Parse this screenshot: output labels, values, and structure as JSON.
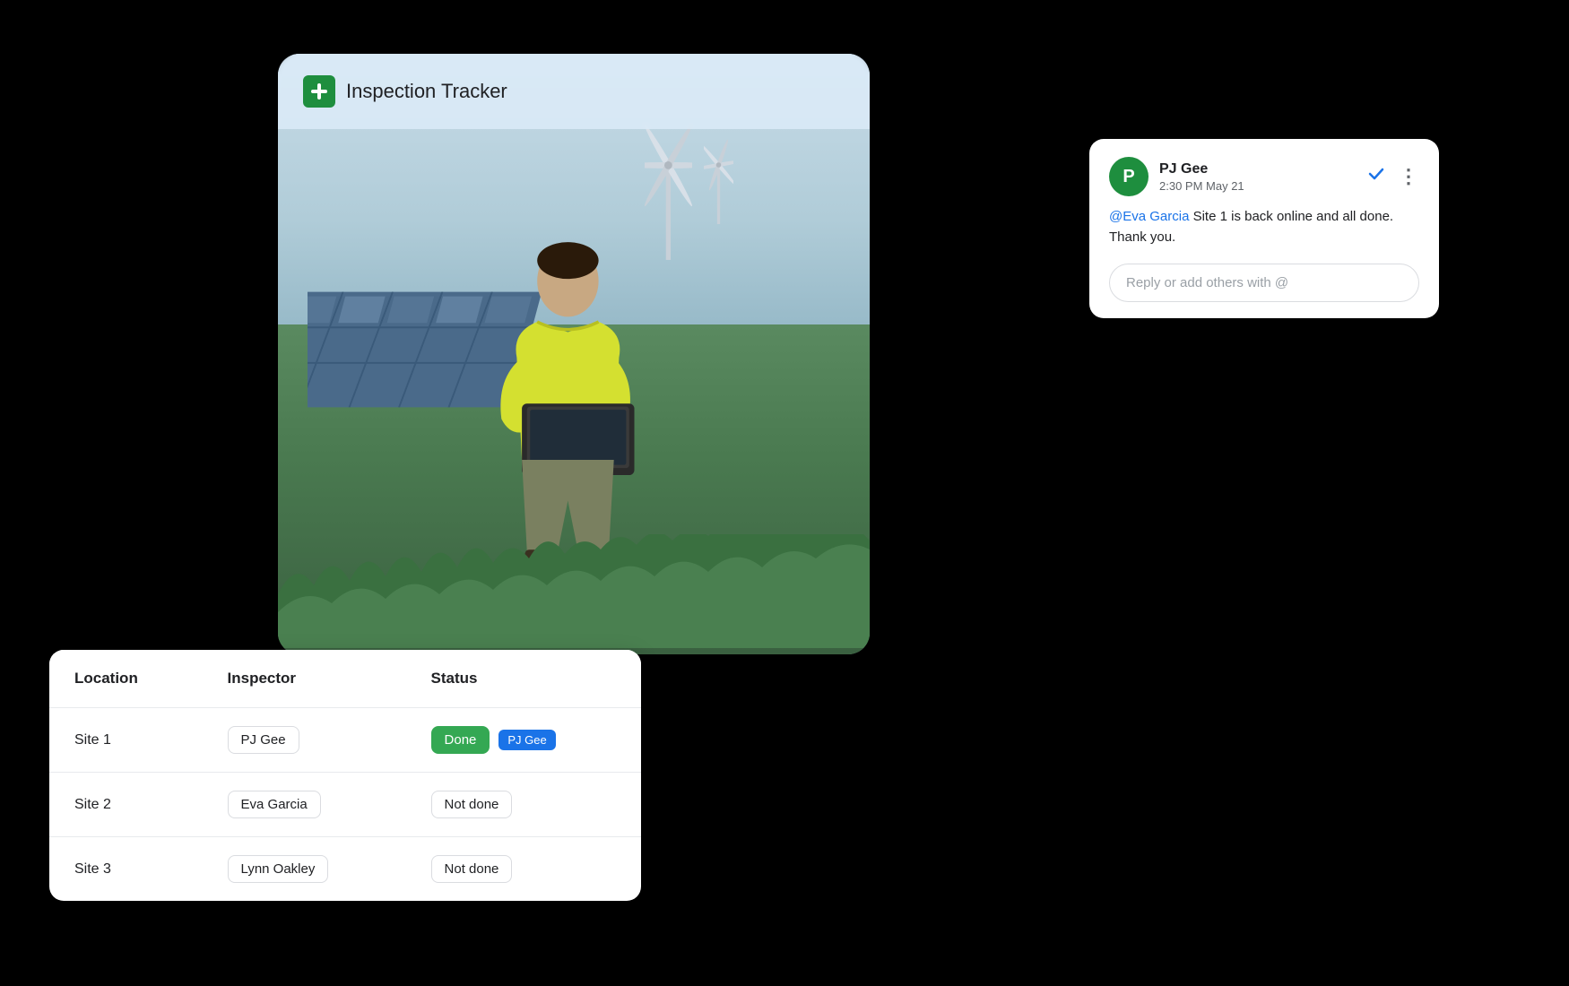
{
  "app": {
    "title": "Inspection Tracker",
    "icon_symbol": "+"
  },
  "comment_card": {
    "commenter": {
      "name": "PJ Gee",
      "avatar_letter": "P",
      "time": "2:30 PM May 21"
    },
    "message_prefix": "@Eva Garcia",
    "message_body": " Site 1 is back online and all done. Thank you.",
    "reply_placeholder": "Reply or add others with @"
  },
  "table": {
    "headers": [
      "Location",
      "Inspector",
      "Status"
    ],
    "rows": [
      {
        "location": "Site 1",
        "inspector": "PJ Gee",
        "status": "Done",
        "status_done": true,
        "tag": "PJ Gee"
      },
      {
        "location": "Site 2",
        "inspector": "Eva Garcia",
        "status": "Not done",
        "status_done": false,
        "tag": null
      },
      {
        "location": "Site 3",
        "inspector": "Lynn Oakley",
        "status": "Not done",
        "status_done": false,
        "tag": null
      }
    ]
  },
  "colors": {
    "green_accent": "#34a853",
    "blue_accent": "#1a73e8",
    "icon_bg": "#1e8e3e"
  }
}
